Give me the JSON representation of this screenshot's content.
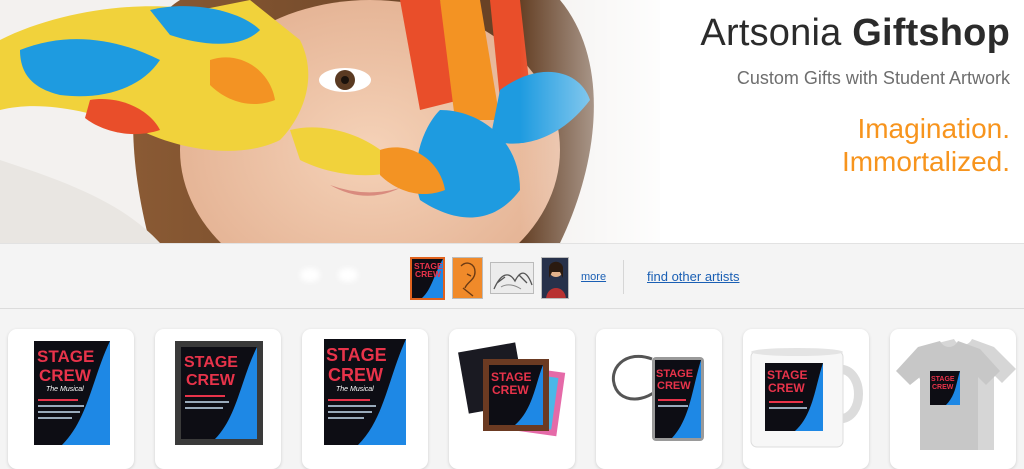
{
  "brand": {
    "name_light": "Artsonia",
    "name_bold": "Giftshop"
  },
  "tagline": "Custom Gifts with Student Artwork",
  "slogan": {
    "line1": "Imagination.",
    "line2": "Immortalized."
  },
  "artwork_strip": {
    "more_label": "more",
    "find_label": "find other artists",
    "thumbnails": [
      "stage crew poster",
      "orange sketch",
      "pencil drawing",
      "portrait painting"
    ]
  },
  "poster": {
    "line1": "STAGE",
    "line2": "CREW",
    "subtitle": "The Musical"
  },
  "products": [
    "framed print",
    "dark framed print",
    "print",
    "coasters",
    "luggage tag",
    "mug",
    "t-shirt"
  ],
  "colors": {
    "accent_orange": "#f7941d",
    "link_blue": "#1a5fb4",
    "poster_red": "#e8334a",
    "poster_blue": "#1e88e5"
  }
}
